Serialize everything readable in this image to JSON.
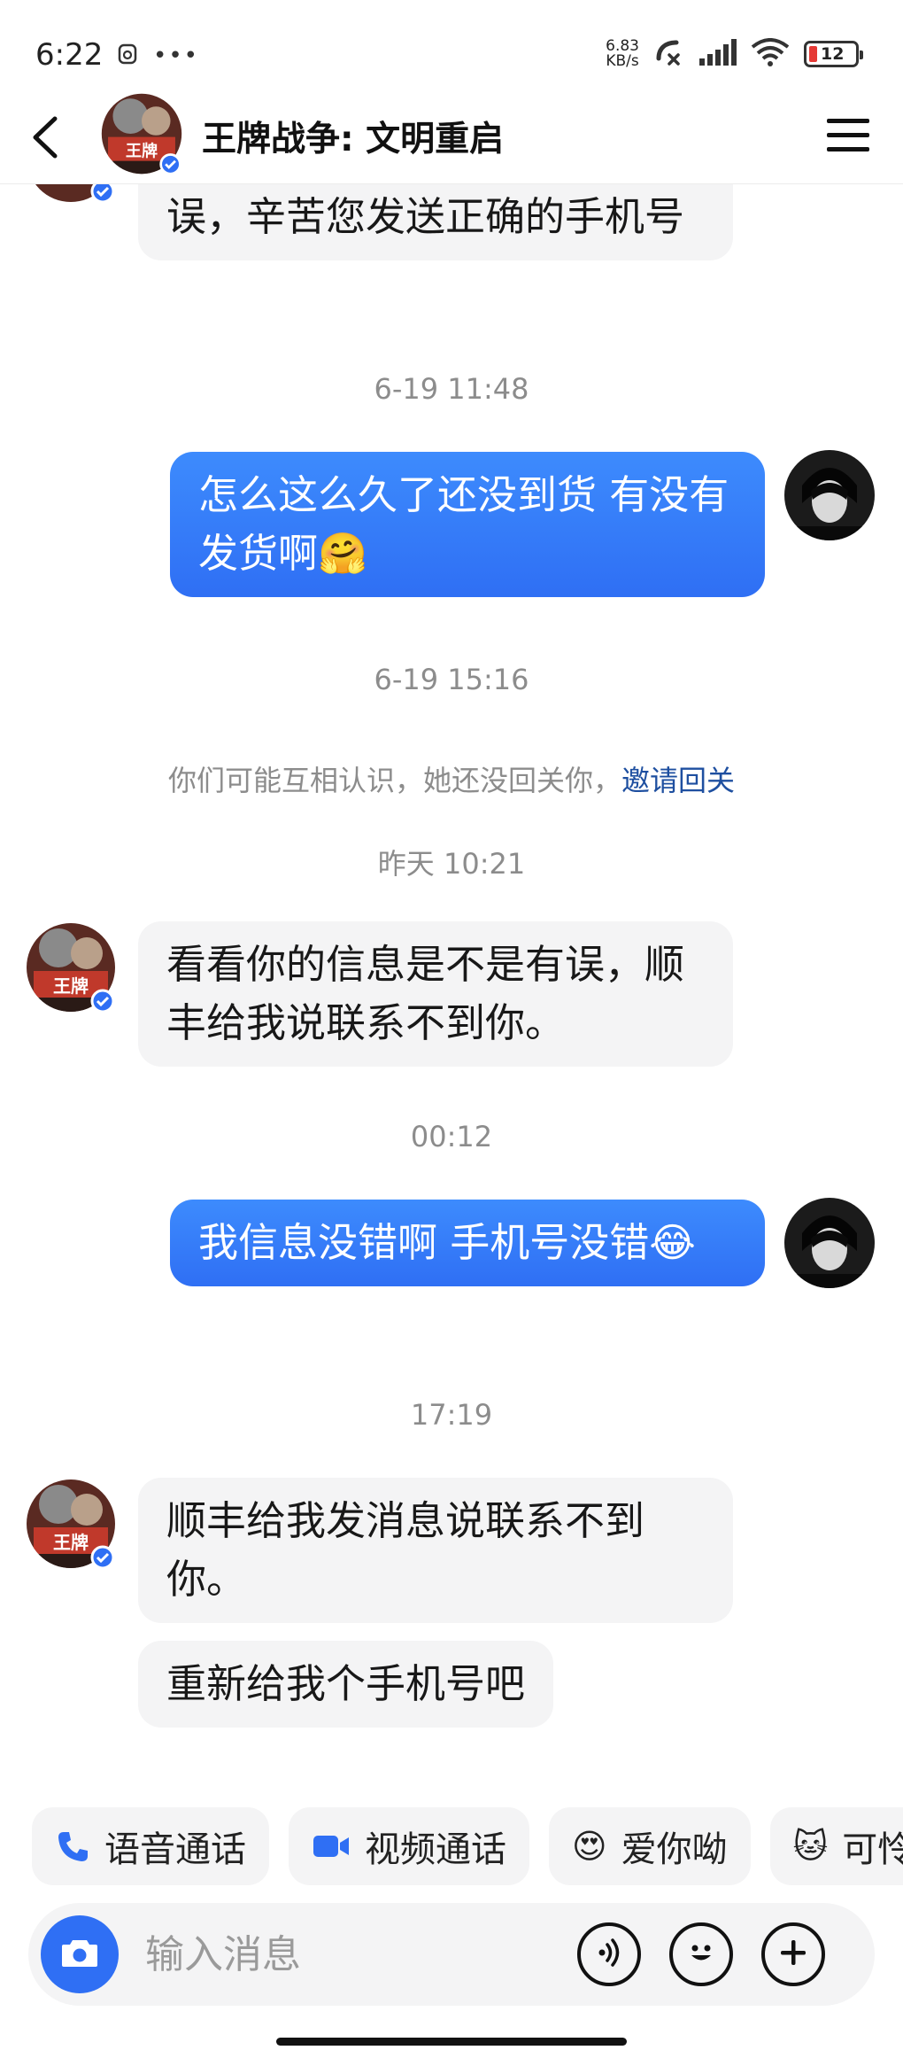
{
  "status_bar": {
    "time": "6:22",
    "dots": "•••",
    "net_speed_value": "6.83",
    "net_speed_unit": "KB/s",
    "battery": "12"
  },
  "header": {
    "title": "王牌战争: 文明重启"
  },
  "messages": {
    "m1": "误，辛苦您发送正确的手机号",
    "ts1": "6-19 11:48",
    "m2": "怎么这么久了还没到货 有没有发货啊🤗",
    "ts2": "6-19 15:16",
    "notice_text": "你们可能互相认识，她还没回关你，",
    "notice_link": "邀请回关",
    "ts3": "昨天 10:21",
    "m3": "看看你的信息是不是有误，顺丰给我说联系不到你。",
    "ts4": "00:12",
    "m4": "我信息没错啊 手机号没错😂",
    "ts5": "17:19",
    "m5": "顺丰给我发消息说联系不到你。",
    "m6": "重新给我个手机号吧"
  },
  "quick_actions": [
    {
      "label": "语音通话",
      "icon": "phone-icon"
    },
    {
      "label": "视频通话",
      "icon": "video-camera-icon"
    },
    {
      "label": "爱你呦",
      "icon": "heart-eyes-emoji-icon",
      "glyph": "😍"
    },
    {
      "label": "可怜",
      "icon": "pleading-cat-emoji-icon",
      "glyph": "🐱"
    }
  ],
  "input": {
    "placeholder": "输入消息"
  },
  "colors": {
    "accent_blue": "#2f6ff4",
    "bubble_in": "#f4f4f5",
    "timestamp_gray": "#8c8c8c",
    "link_blue": "#1e4fa0"
  }
}
